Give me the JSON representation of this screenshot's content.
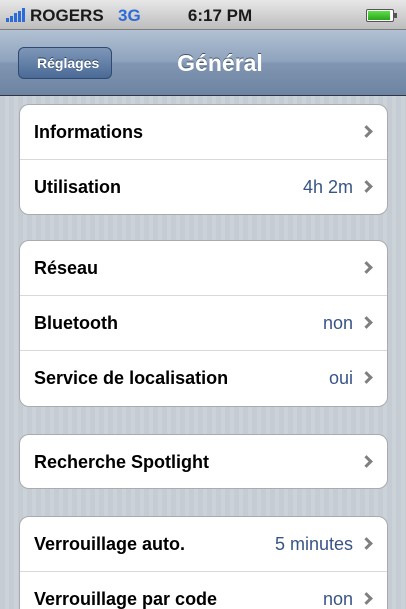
{
  "status_bar": {
    "carrier": "ROGERS",
    "network": "3G",
    "time": "6:17 PM",
    "battery_level": 0.85
  },
  "nav": {
    "back_label": "Réglages",
    "title": "Général"
  },
  "groups": [
    {
      "items": [
        {
          "label": "Informations",
          "value": ""
        },
        {
          "label": "Utilisation",
          "value": "4h 2m"
        }
      ]
    },
    {
      "items": [
        {
          "label": "Réseau",
          "value": ""
        },
        {
          "label": "Bluetooth",
          "value": "non"
        },
        {
          "label": "Service de localisation",
          "value": "oui"
        }
      ]
    },
    {
      "items": [
        {
          "label": "Recherche Spotlight",
          "value": ""
        }
      ]
    },
    {
      "items": [
        {
          "label": "Verrouillage auto.",
          "value": "5 minutes"
        },
        {
          "label": "Verrouillage par code",
          "value": "non"
        }
      ]
    }
  ],
  "colors": {
    "value_text": "#385487",
    "signal": "#2d6bd8",
    "battery": "#3cc22a"
  }
}
